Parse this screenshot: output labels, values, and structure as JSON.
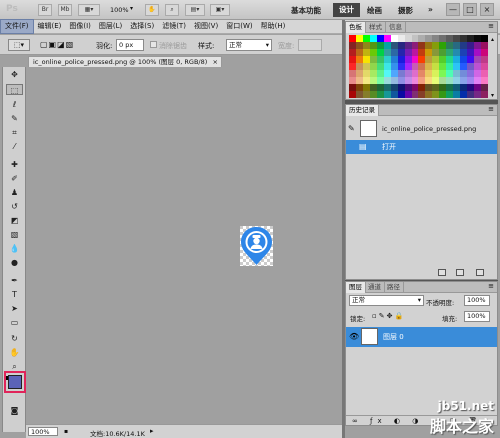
{
  "app": {
    "logo": "Ps",
    "bridge_btn": "Br",
    "mini_btn": "Mb",
    "zoom_level": "100%",
    "workspaces": [
      "基本功能",
      "设计",
      "绘画",
      "摄影"
    ],
    "workspace_more": "»"
  },
  "window_controls": {
    "minimize": "—",
    "restore": "□",
    "close": "×"
  },
  "menu": [
    "文件(F)",
    "编辑(E)",
    "图像(I)",
    "图层(L)",
    "选择(S)",
    "滤镜(T)",
    "视图(V)",
    "窗口(W)",
    "帮助(H)"
  ],
  "options": {
    "feather_label": "羽化:",
    "feather_value": "0 px",
    "antialias_label": "消除锯齿",
    "style_label": "样式:",
    "style_value": "正常",
    "width_label": "宽度:"
  },
  "document": {
    "tab_title": "ic_online_police_pressed.png @ 100% (图层 0, RGB/8)",
    "tab_close": "×"
  },
  "status": {
    "zoom": "100%",
    "doc_info": "文档:10.6K/14.1K"
  },
  "swatches_panel": {
    "tabs": [
      "色板",
      "样式",
      "信息"
    ],
    "colors_row": [
      "#ff0000",
      "#ffff00",
      "#00ff00",
      "#00ffff",
      "#0000ff",
      "#ff00ff",
      "#ffffff",
      "#ebebeb",
      "#d6d6d6",
      "#c2c2c2",
      "#adadad",
      "#999999",
      "#858585",
      "#707070",
      "#5c5c5c",
      "#474747",
      "#333333",
      "#1f1f1f",
      "#0a0a0a",
      "#000000"
    ]
  },
  "history_panel": {
    "title": "历史记录",
    "snapshot_name": "ic_online_police_pressed.png",
    "steps": [
      "打开"
    ]
  },
  "layers_panel": {
    "tabs": [
      "图层",
      "通道",
      "路径"
    ],
    "blend_mode": "正常",
    "opacity_label": "不透明度:",
    "opacity_value": "100%",
    "lock_label": "锁定:",
    "fill_label": "填充:",
    "fill_value": "100%",
    "layers": [
      {
        "name": "图层 0"
      }
    ]
  },
  "watermark": {
    "url": "jb51.net",
    "name": "脚本之家"
  },
  "colors": {
    "accent": "#3a8cd9",
    "foreground": "#5b63b8",
    "icon_blue": "#2e86e8"
  }
}
